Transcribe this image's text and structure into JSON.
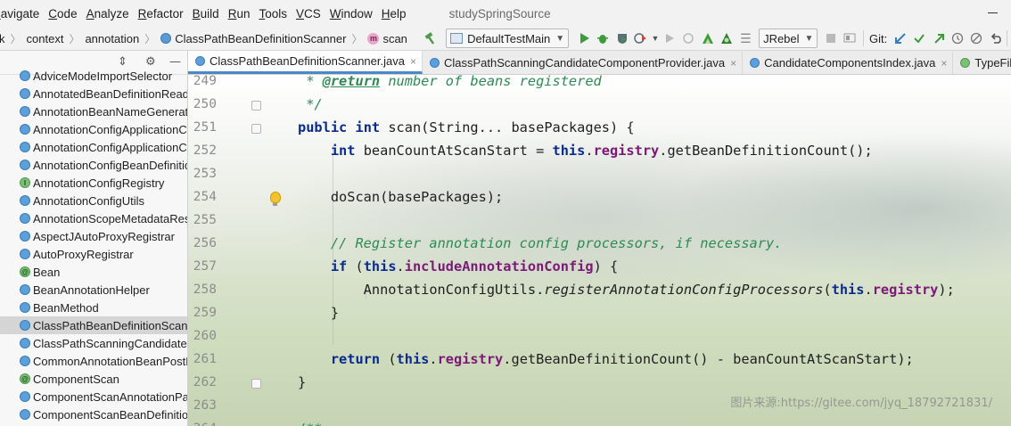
{
  "menubar": {
    "items": [
      "Navigate",
      "Code",
      "Analyze",
      "Refactor",
      "Build",
      "Run",
      "Tools",
      "VCS",
      "Window",
      "Help"
    ],
    "mnemonics": [
      "N",
      "C",
      "A",
      "R",
      "B",
      "R",
      "T",
      "V",
      "W",
      "H"
    ],
    "project_title": "studySpringSource"
  },
  "toolbar": {
    "breadcrumbs": [
      "k",
      "context",
      "annotation",
      "ClassPathBeanDefinitionScanner",
      "scan"
    ],
    "run_config": "DefaultTestMain",
    "jrebel": "JRebel",
    "git_label": "Git:",
    "icons": [
      "hammer-icon",
      "run-icon",
      "debug-icon",
      "coverage-icon",
      "profile-icon",
      "stop-icon"
    ]
  },
  "project_panel": {
    "items": [
      {
        "label": "AdviceModeImportSelector",
        "kind": "class"
      },
      {
        "label": "AnnotatedBeanDefinitionReader",
        "kind": "class"
      },
      {
        "label": "AnnotationBeanNameGenerator",
        "kind": "class"
      },
      {
        "label": "AnnotationConfigApplicationContext",
        "kind": "class"
      },
      {
        "label": "AnnotationConfigApplicationContextExt",
        "kind": "class"
      },
      {
        "label": "AnnotationConfigBeanDefinitionParser",
        "kind": "class"
      },
      {
        "label": "AnnotationConfigRegistry",
        "kind": "interface"
      },
      {
        "label": "AnnotationConfigUtils",
        "kind": "class"
      },
      {
        "label": "AnnotationScopeMetadataResolver",
        "kind": "class"
      },
      {
        "label": "AspectJAutoProxyRegistrar",
        "kind": "class"
      },
      {
        "label": "AutoProxyRegistrar",
        "kind": "class"
      },
      {
        "label": "Bean",
        "kind": "annotation"
      },
      {
        "label": "BeanAnnotationHelper",
        "kind": "class"
      },
      {
        "label": "BeanMethod",
        "kind": "class"
      },
      {
        "label": "ClassPathBeanDefinitionScanner",
        "kind": "class",
        "selected": true
      },
      {
        "label": "ClassPathScanningCandidateComponentProvider",
        "kind": "class"
      },
      {
        "label": "CommonAnnotationBeanPostProcessor",
        "kind": "class"
      },
      {
        "label": "ComponentScan",
        "kind": "annotation"
      },
      {
        "label": "ComponentScanAnnotationParser",
        "kind": "class"
      },
      {
        "label": "ComponentScanBeanDefinitionParser",
        "kind": "class"
      }
    ]
  },
  "editor_tabs": [
    {
      "label": "ClassPathBeanDefinitionScanner.java",
      "active": true,
      "kind": "class"
    },
    {
      "label": "ClassPathScanningCandidateComponentProvider.java",
      "active": false,
      "kind": "class"
    },
    {
      "label": "CandidateComponentsIndex.java",
      "active": false,
      "kind": "class"
    },
    {
      "label": "TypeFilter",
      "active": false,
      "kind": "interface"
    }
  ],
  "editor": {
    "line_numbers": [
      "249",
      "250",
      "251",
      "252",
      "253",
      "254",
      "255",
      "256",
      "257",
      "258",
      "259",
      "260",
      "261",
      "262",
      "263",
      "264"
    ],
    "code_lines": [
      [
        {
          "t": "doc",
          "v": " * "
        },
        {
          "t": "doc-tag",
          "v": "@return"
        },
        {
          "t": "doc",
          "v": " number of beans registered"
        }
      ],
      [
        {
          "t": "doc",
          "v": " */"
        }
      ],
      [
        {
          "t": "kw",
          "v": "public"
        },
        {
          "t": "",
          "v": " "
        },
        {
          "t": "kw",
          "v": "int"
        },
        {
          "t": "",
          "v": " scan(String... basePackages) {"
        }
      ],
      [
        {
          "t": "",
          "v": "    "
        },
        {
          "t": "kw",
          "v": "int"
        },
        {
          "t": "",
          "v": " beanCountAtScanStart = "
        },
        {
          "t": "kw",
          "v": "this"
        },
        {
          "t": "",
          "v": "."
        },
        {
          "t": "field",
          "v": "registry"
        },
        {
          "t": "",
          "v": ".getBeanDefinitionCount();"
        }
      ],
      [],
      [
        {
          "t": "",
          "v": "    doScan(basePackages);"
        }
      ],
      [],
      [
        {
          "t": "",
          "v": "    "
        },
        {
          "t": "cmt",
          "v": "// Register annotation config processors, if necessary."
        }
      ],
      [
        {
          "t": "",
          "v": "    "
        },
        {
          "t": "kw",
          "v": "if"
        },
        {
          "t": "",
          "v": " ("
        },
        {
          "t": "kw",
          "v": "this"
        },
        {
          "t": "",
          "v": "."
        },
        {
          "t": "field",
          "v": "includeAnnotationConfig"
        },
        {
          "t": "",
          "v": ") {"
        }
      ],
      [
        {
          "t": "",
          "v": "        AnnotationConfigUtils."
        },
        {
          "t": "static-call",
          "v": "registerAnnotationConfigProcessors"
        },
        {
          "t": "",
          "v": "("
        },
        {
          "t": "kw",
          "v": "this"
        },
        {
          "t": "",
          "v": "."
        },
        {
          "t": "field",
          "v": "registry"
        },
        {
          "t": "",
          "v": ");"
        }
      ],
      [
        {
          "t": "",
          "v": "    }"
        }
      ],
      [],
      [
        {
          "t": "",
          "v": "    "
        },
        {
          "t": "kw",
          "v": "return"
        },
        {
          "t": "",
          "v": " ("
        },
        {
          "t": "kw",
          "v": "this"
        },
        {
          "t": "",
          "v": "."
        },
        {
          "t": "field",
          "v": "registry"
        },
        {
          "t": "",
          "v": ".getBeanDefinitionCount() - beanCountAtScanStart);"
        }
      ],
      [
        {
          "t": "",
          "v": "}"
        }
      ],
      [],
      [
        {
          "t": "doc",
          "v": "/**"
        }
      ]
    ],
    "watermark": "图片来源:https://gitee.com/jyq_18792721831/"
  }
}
